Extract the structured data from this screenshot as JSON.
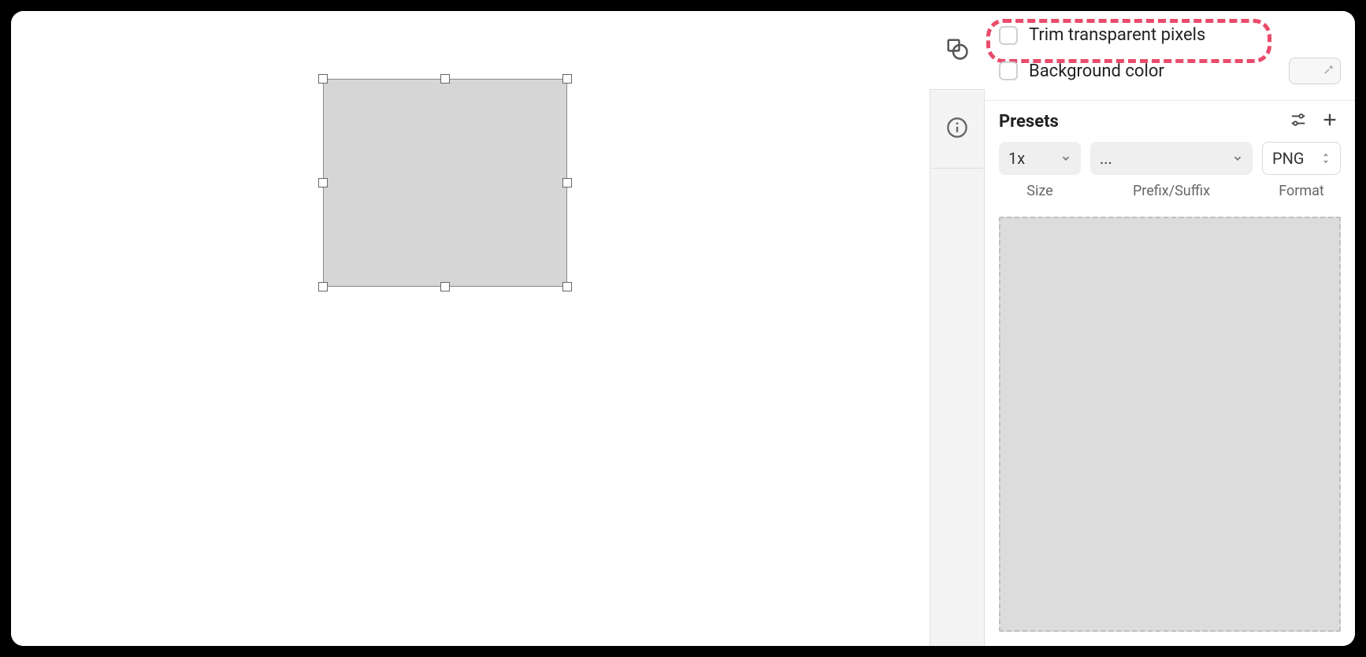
{
  "export_options": {
    "trim_transparent_pixels": {
      "label": "Trim transparent pixels",
      "checked": false
    },
    "background_color": {
      "label": "Background color",
      "checked": false
    }
  },
  "presets": {
    "title": "Presets",
    "row": {
      "size": {
        "value": "1x",
        "caption": "Size"
      },
      "prefix_suffix": {
        "value": "...",
        "caption": "Prefix/Suffix"
      },
      "format": {
        "value": "PNG",
        "caption": "Format"
      }
    }
  }
}
